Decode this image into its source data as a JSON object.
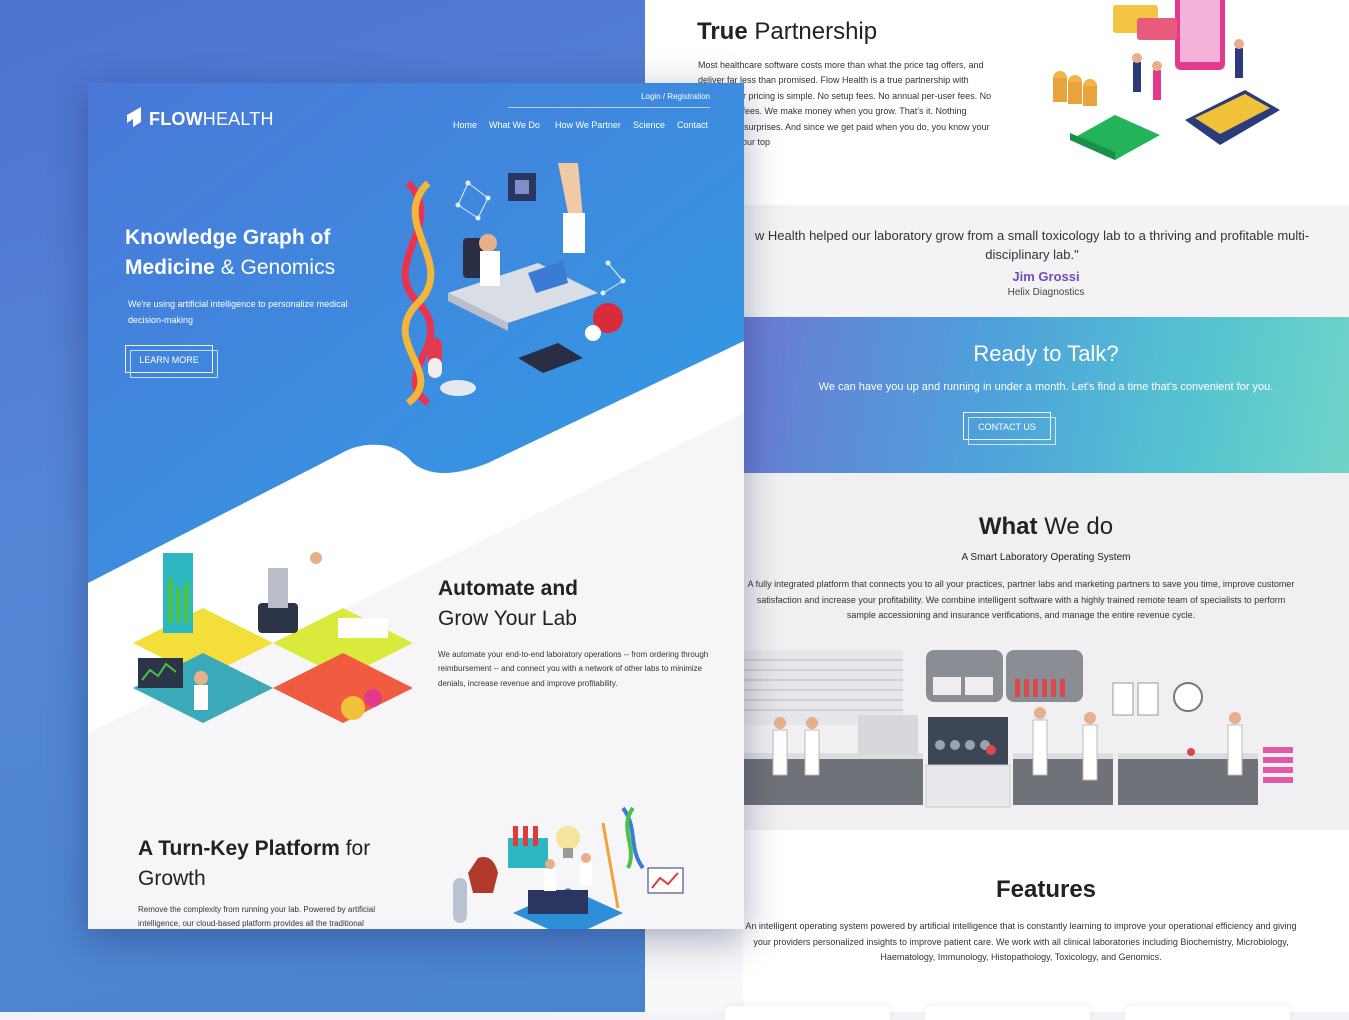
{
  "partnership": {
    "title_bold": "True",
    "title_light": "Partnership",
    "body": "Most healthcare software costs more than what the price tag offers, and deliver far less than promised. Flow Health is a true partnership with returns. Our pricing is simple. No setup fees. No annual per-user fees. No integration fees. We make money when you grow. That's it. Nothing hidden. No surprises. And since we get paid when you do, you know your success is our top"
  },
  "testimonial": {
    "quote": "w Health helped our laboratory grow from a small toxicology lab to a thriving and profitable multi-disciplinary lab.\"",
    "name": "Jim Grossi",
    "company": "Helix Diagnostics"
  },
  "talk": {
    "title": "Ready to Talk?",
    "text": "We can have you up and running in under a month. Let's find a time that's convenient for you.",
    "button": "CONTACT US"
  },
  "what_we_do": {
    "title_bold": "What",
    "title_light": "We do",
    "subtitle": "A Smart Laboratory Operating System",
    "description": "A fully integrated platform that connects you to all your practices, partner labs and marketing partners to save you time, improve customer satisfaction and increase your profitability. We combine intelligent software with a highly trained remote team of specialists to perform sample accessioning and insurance verifications, and manage the entire revenue cycle."
  },
  "features": {
    "title": "Features",
    "description": "An intelligent operating system powered by artificial intelligence that is constantly learning to improve your operational efficiency and giving your providers personalized insights to improve patient care. We work with all clinical laboratories including Biochemistry, Microbiology, Haematology, Immunology, Histopathology, Toxicology, and Genomics."
  },
  "mockup": {
    "logo_bold": "FLOW",
    "logo_light": "HEALTH",
    "login": "Login / Registration",
    "nav": [
      "Home",
      "What We Do",
      "How We Partner",
      "Science",
      "Contact"
    ],
    "hero_title_line1": "Knowledge Graph of",
    "hero_title_bold2": "Medicine",
    "hero_title_light2": "& Genomics",
    "hero_text": "We're using artificial intelligence to personalize medical decision-making",
    "learn_more": "LEARN MORE",
    "automate_bold": "Automate and",
    "automate_light": "Grow Your Lab",
    "automate_text": "We automate your end-to-end laboratory operations -- from ordering through reimbursement -- and connect you with a network of other labs to minimize denials, increase revenue and improve profitability.",
    "turnkey_bold": "A Turn-Key Platform",
    "turnkey_light1": "for",
    "turnkey_light2": "Growth",
    "turnkey_text": "Remove the complexity from running your lab. Powered by artificial intelligence, our cloud-based platform provides all the traditional"
  },
  "colors": {
    "brand_purple": "#6a4fb8",
    "hero_blue": "#3d8fe0",
    "teal": "#56c5d0",
    "background_blue": "#4f73d0"
  }
}
